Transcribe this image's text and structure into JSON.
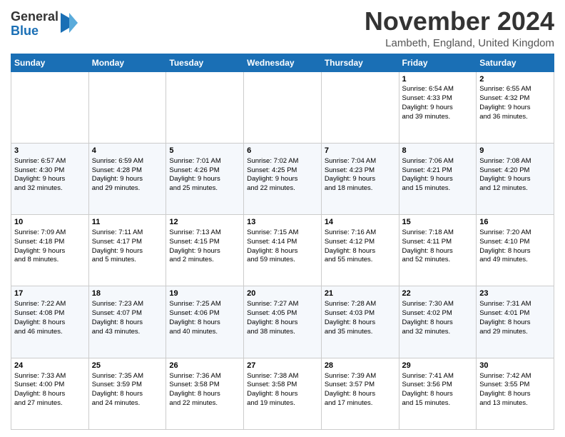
{
  "logo": {
    "line1": "General",
    "line2": "Blue"
  },
  "title": "November 2024",
  "location": "Lambeth, England, United Kingdom",
  "weekdays": [
    "Sunday",
    "Monday",
    "Tuesday",
    "Wednesday",
    "Thursday",
    "Friday",
    "Saturday"
  ],
  "weeks": [
    [
      {
        "day": "",
        "info": ""
      },
      {
        "day": "",
        "info": ""
      },
      {
        "day": "",
        "info": ""
      },
      {
        "day": "",
        "info": ""
      },
      {
        "day": "",
        "info": ""
      },
      {
        "day": "1",
        "info": "Sunrise: 6:54 AM\nSunset: 4:33 PM\nDaylight: 9 hours\nand 39 minutes."
      },
      {
        "day": "2",
        "info": "Sunrise: 6:55 AM\nSunset: 4:32 PM\nDaylight: 9 hours\nand 36 minutes."
      }
    ],
    [
      {
        "day": "3",
        "info": "Sunrise: 6:57 AM\nSunset: 4:30 PM\nDaylight: 9 hours\nand 32 minutes."
      },
      {
        "day": "4",
        "info": "Sunrise: 6:59 AM\nSunset: 4:28 PM\nDaylight: 9 hours\nand 29 minutes."
      },
      {
        "day": "5",
        "info": "Sunrise: 7:01 AM\nSunset: 4:26 PM\nDaylight: 9 hours\nand 25 minutes."
      },
      {
        "day": "6",
        "info": "Sunrise: 7:02 AM\nSunset: 4:25 PM\nDaylight: 9 hours\nand 22 minutes."
      },
      {
        "day": "7",
        "info": "Sunrise: 7:04 AM\nSunset: 4:23 PM\nDaylight: 9 hours\nand 18 minutes."
      },
      {
        "day": "8",
        "info": "Sunrise: 7:06 AM\nSunset: 4:21 PM\nDaylight: 9 hours\nand 15 minutes."
      },
      {
        "day": "9",
        "info": "Sunrise: 7:08 AM\nSunset: 4:20 PM\nDaylight: 9 hours\nand 12 minutes."
      }
    ],
    [
      {
        "day": "10",
        "info": "Sunrise: 7:09 AM\nSunset: 4:18 PM\nDaylight: 9 hours\nand 8 minutes."
      },
      {
        "day": "11",
        "info": "Sunrise: 7:11 AM\nSunset: 4:17 PM\nDaylight: 9 hours\nand 5 minutes."
      },
      {
        "day": "12",
        "info": "Sunrise: 7:13 AM\nSunset: 4:15 PM\nDaylight: 9 hours\nand 2 minutes."
      },
      {
        "day": "13",
        "info": "Sunrise: 7:15 AM\nSunset: 4:14 PM\nDaylight: 8 hours\nand 59 minutes."
      },
      {
        "day": "14",
        "info": "Sunrise: 7:16 AM\nSunset: 4:12 PM\nDaylight: 8 hours\nand 55 minutes."
      },
      {
        "day": "15",
        "info": "Sunrise: 7:18 AM\nSunset: 4:11 PM\nDaylight: 8 hours\nand 52 minutes."
      },
      {
        "day": "16",
        "info": "Sunrise: 7:20 AM\nSunset: 4:10 PM\nDaylight: 8 hours\nand 49 minutes."
      }
    ],
    [
      {
        "day": "17",
        "info": "Sunrise: 7:22 AM\nSunset: 4:08 PM\nDaylight: 8 hours\nand 46 minutes."
      },
      {
        "day": "18",
        "info": "Sunrise: 7:23 AM\nSunset: 4:07 PM\nDaylight: 8 hours\nand 43 minutes."
      },
      {
        "day": "19",
        "info": "Sunrise: 7:25 AM\nSunset: 4:06 PM\nDaylight: 8 hours\nand 40 minutes."
      },
      {
        "day": "20",
        "info": "Sunrise: 7:27 AM\nSunset: 4:05 PM\nDaylight: 8 hours\nand 38 minutes."
      },
      {
        "day": "21",
        "info": "Sunrise: 7:28 AM\nSunset: 4:03 PM\nDaylight: 8 hours\nand 35 minutes."
      },
      {
        "day": "22",
        "info": "Sunrise: 7:30 AM\nSunset: 4:02 PM\nDaylight: 8 hours\nand 32 minutes."
      },
      {
        "day": "23",
        "info": "Sunrise: 7:31 AM\nSunset: 4:01 PM\nDaylight: 8 hours\nand 29 minutes."
      }
    ],
    [
      {
        "day": "24",
        "info": "Sunrise: 7:33 AM\nSunset: 4:00 PM\nDaylight: 8 hours\nand 27 minutes."
      },
      {
        "day": "25",
        "info": "Sunrise: 7:35 AM\nSunset: 3:59 PM\nDaylight: 8 hours\nand 24 minutes."
      },
      {
        "day": "26",
        "info": "Sunrise: 7:36 AM\nSunset: 3:58 PM\nDaylight: 8 hours\nand 22 minutes."
      },
      {
        "day": "27",
        "info": "Sunrise: 7:38 AM\nSunset: 3:58 PM\nDaylight: 8 hours\nand 19 minutes."
      },
      {
        "day": "28",
        "info": "Sunrise: 7:39 AM\nSunset: 3:57 PM\nDaylight: 8 hours\nand 17 minutes."
      },
      {
        "day": "29",
        "info": "Sunrise: 7:41 AM\nSunset: 3:56 PM\nDaylight: 8 hours\nand 15 minutes."
      },
      {
        "day": "30",
        "info": "Sunrise: 7:42 AM\nSunset: 3:55 PM\nDaylight: 8 hours\nand 13 minutes."
      }
    ]
  ]
}
